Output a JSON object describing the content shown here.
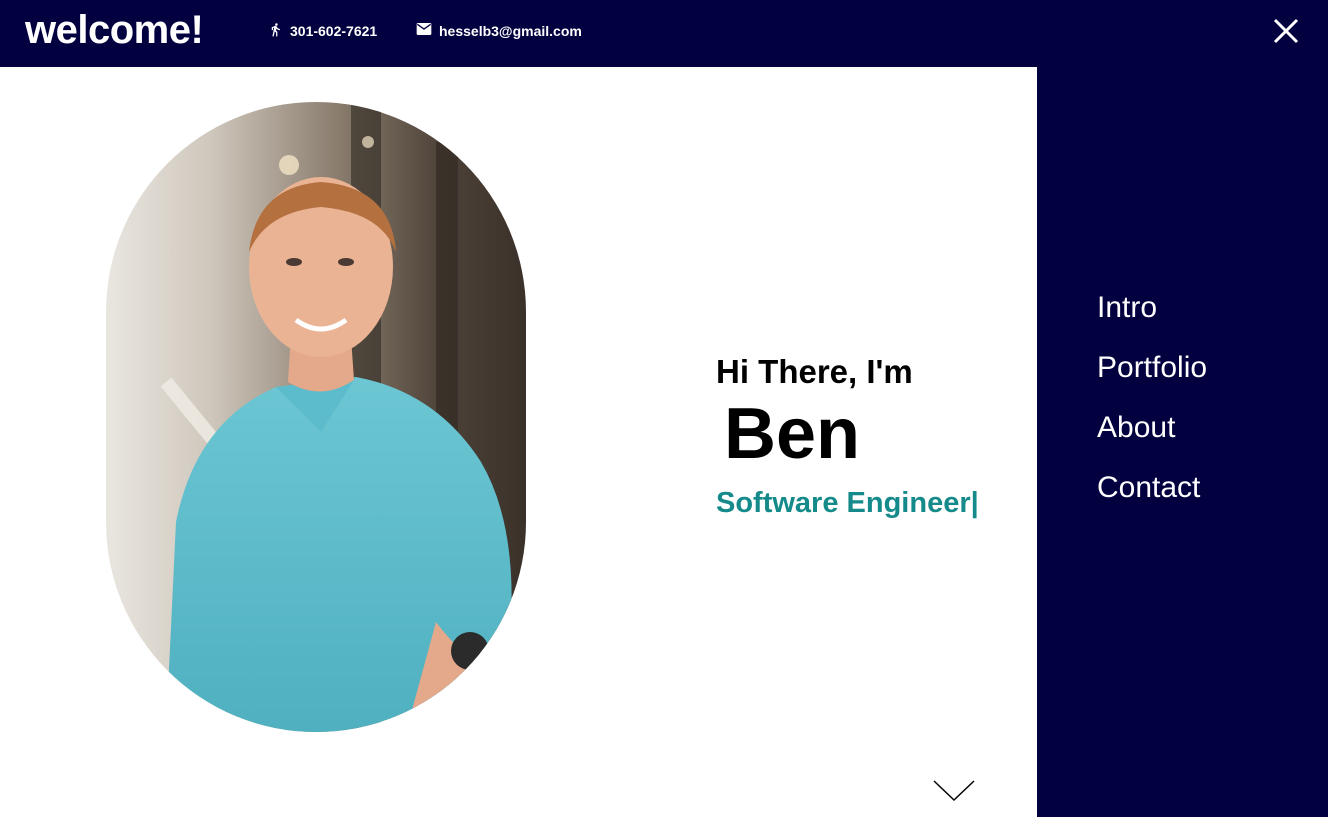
{
  "header": {
    "logo_text": "welcome!",
    "phone": "301-602-7621",
    "email": "hesselb3@gmail.com",
    "phone_icon": "person-icon",
    "email_icon": "mail-icon",
    "close_icon": "close-icon"
  },
  "hero": {
    "greeting": "Hi There, I'm",
    "name": "Ben",
    "role": "Software Engineer|",
    "scroll_icon": "chevron-down-icon"
  },
  "menu": {
    "items": [
      {
        "label": "Intro"
      },
      {
        "label": "Portfolio"
      },
      {
        "label": "About"
      },
      {
        "label": "Contact"
      }
    ]
  },
  "colors": {
    "navy": "#02003f",
    "accent_teal": "#158a8a",
    "white": "#ffffff"
  }
}
